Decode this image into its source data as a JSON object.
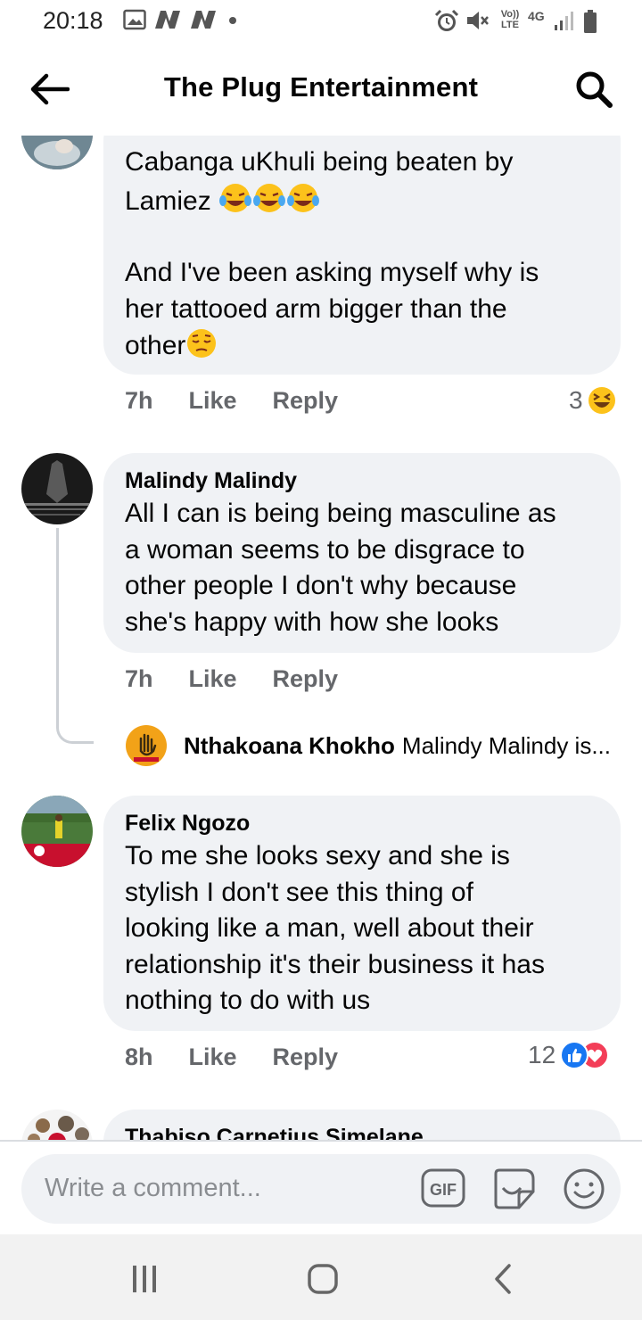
{
  "status_bar": {
    "time": "20:18",
    "network_label": "4G",
    "volte_label": "Vo)) LTE"
  },
  "header": {
    "title": "The Plug Entertainment",
    "back_icon": "arrow-left-icon",
    "search_icon": "search-icon"
  },
  "comments": [
    {
      "text_lines": [
        "Cabanga uKhuli being beaten by",
        "Lamiez"
      ],
      "text_lines_2": [
        "And I've been asking myself why is",
        "her tattooed arm bigger than the",
        "other"
      ],
      "time": "7h",
      "like_label": "Like",
      "reply_label": "Reply",
      "reaction_count": "3",
      "reaction_icon": "laughing-squint-icon"
    },
    {
      "author": "Malindy Malindy",
      "text_lines": [
        "All I can is being being masculine as",
        "a woman seems to be disgrace to",
        "other people I don't why because",
        "she's happy with how she looks"
      ],
      "time": "7h",
      "like_label": "Like",
      "reply_label": "Reply",
      "reply_preview": {
        "author": "Nthakoana Khokho",
        "text": "Malindy Malindy is..."
      }
    },
    {
      "author": "Felix Ngozo",
      "text_lines": [
        "To me she looks sexy and she is",
        "stylish I don't see this thing of",
        "looking like a man, well about their",
        "relationship it's their business it has",
        "nothing to do with us"
      ],
      "time": "8h",
      "like_label": "Like",
      "reply_label": "Reply",
      "reaction_count": "12",
      "reaction_icons": [
        "like-icon",
        "love-icon"
      ]
    },
    {
      "author": "Thabiso Carnetius Simelane"
    }
  ],
  "composer": {
    "placeholder": "Write a comment...",
    "gif_label": "GIF",
    "sticker_icon": "sticker-icon",
    "emoji_icon": "smiley-icon"
  },
  "colors": {
    "bubble": "#f0f2f5",
    "meta_text": "#65676b",
    "like_blue": "#1877f2",
    "love_red": "#f33e58"
  }
}
